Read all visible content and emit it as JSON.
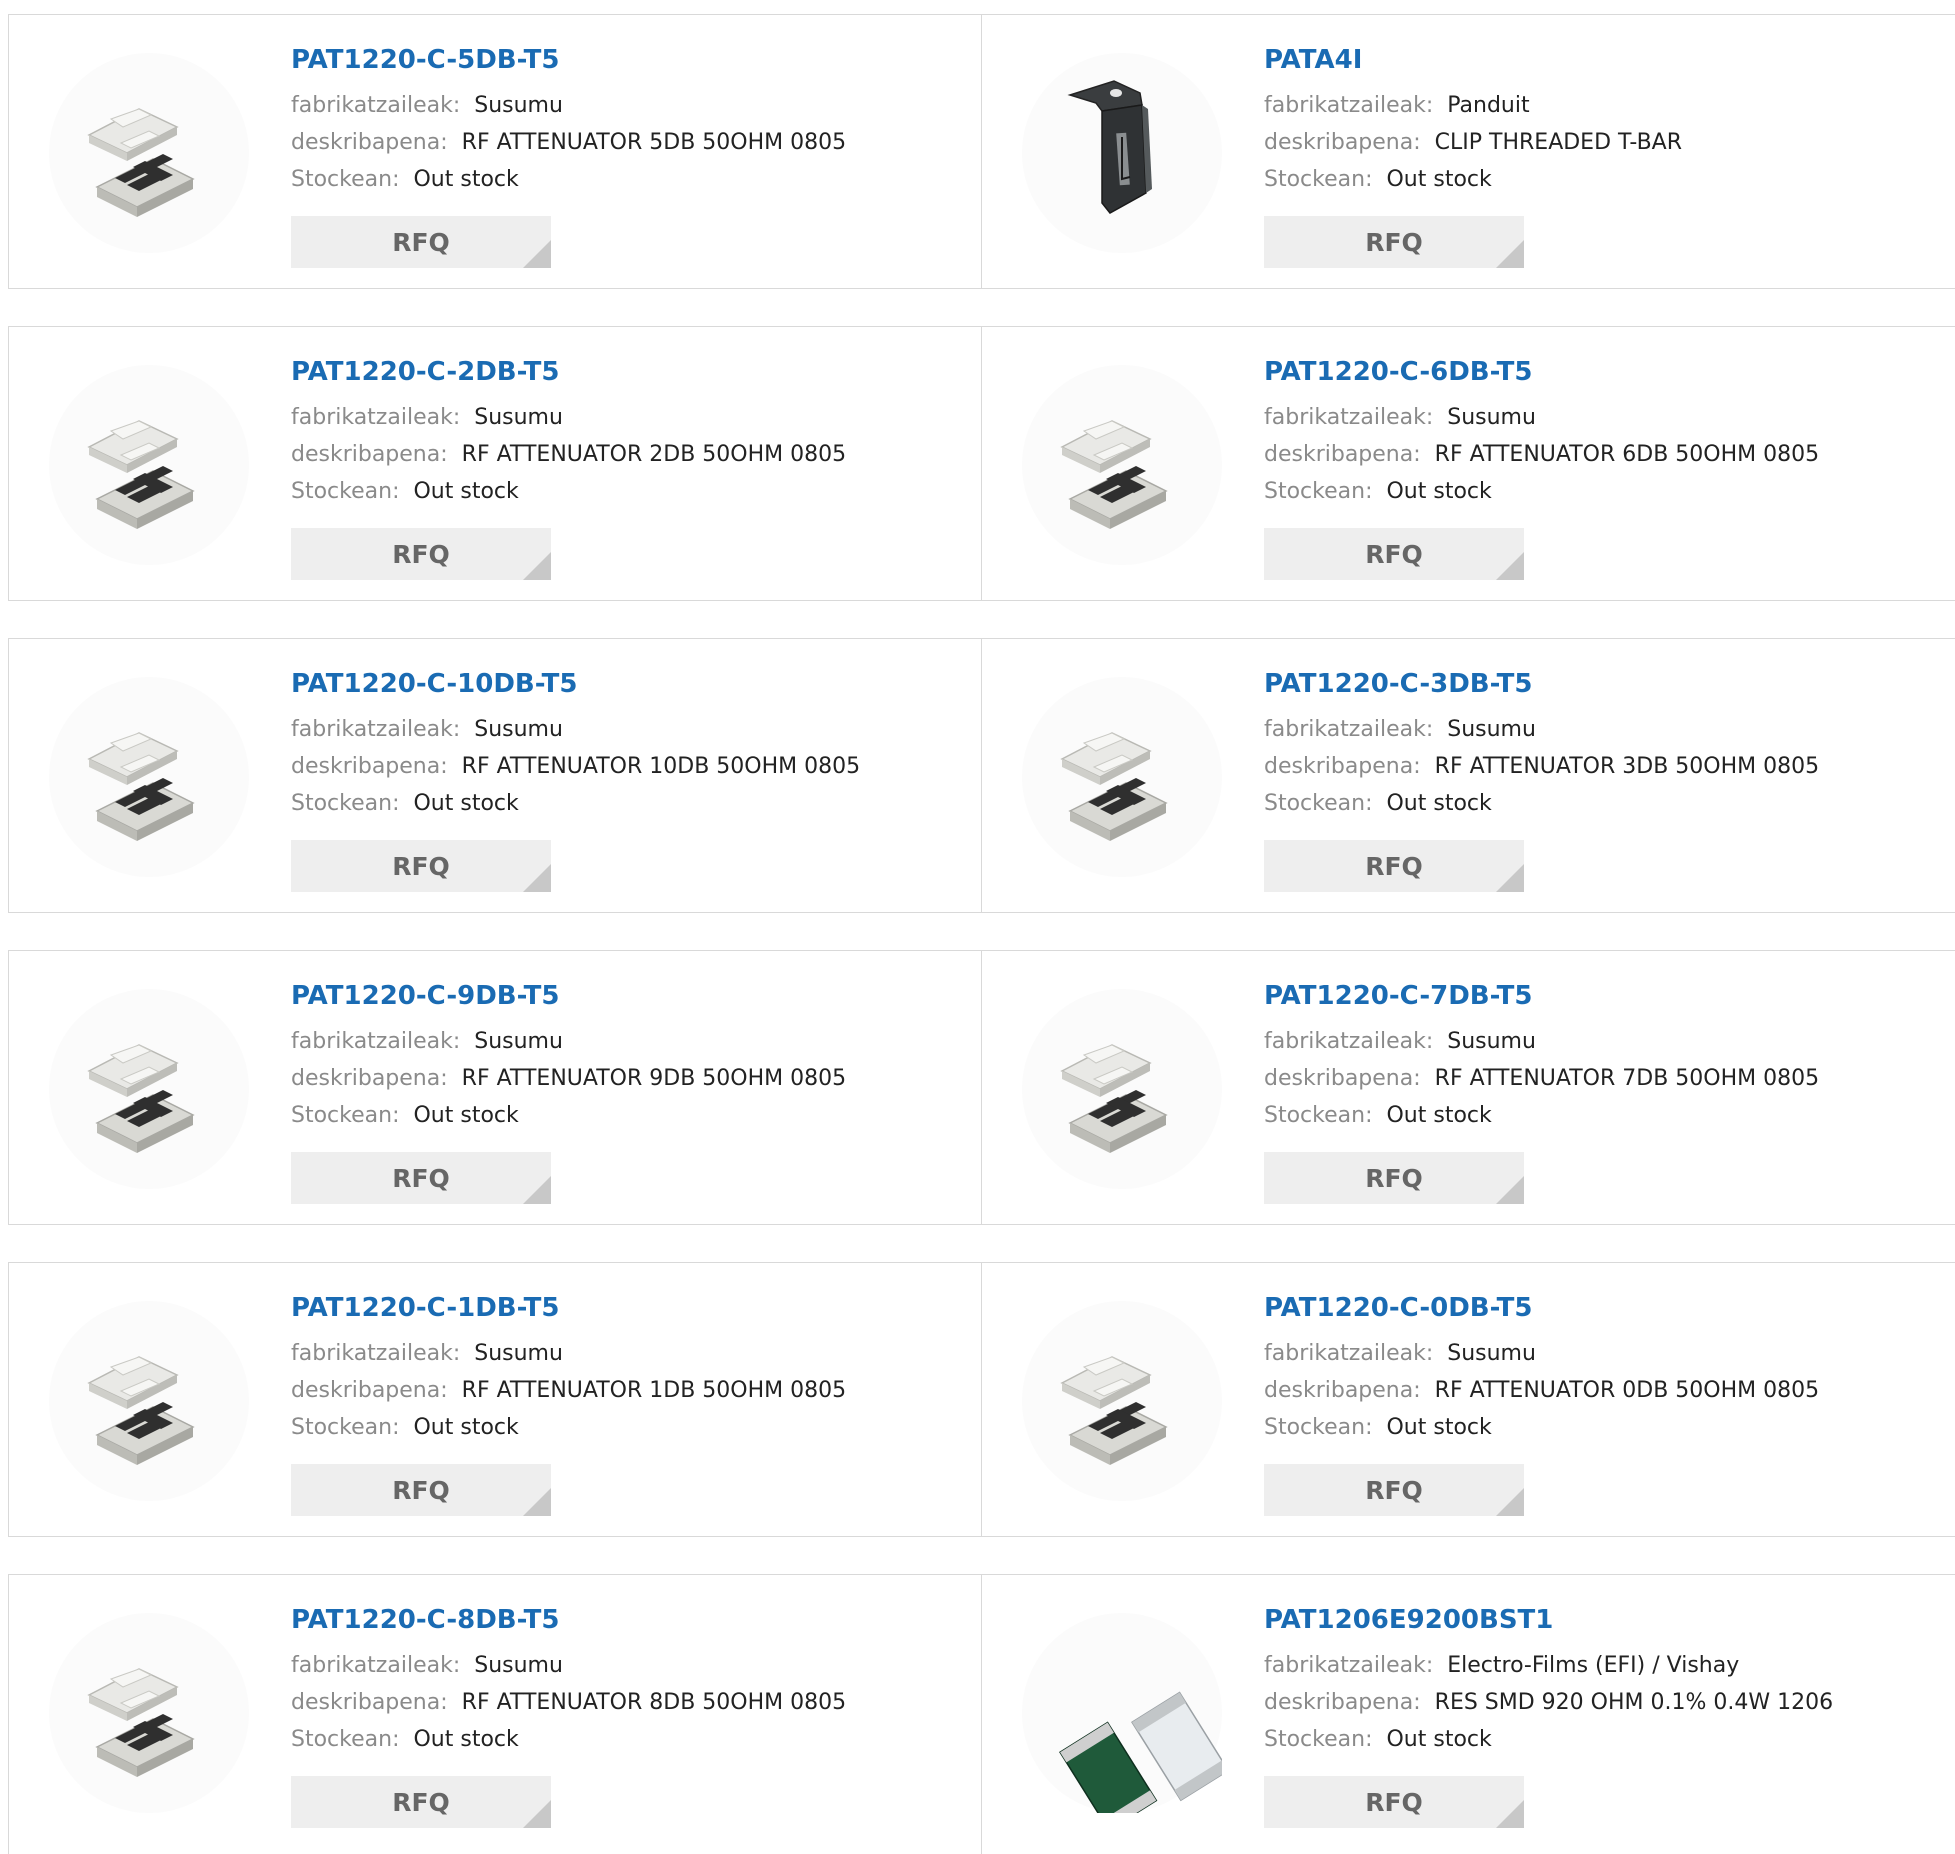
{
  "labels": {
    "manufacturer": "fabrikatzaileak:",
    "description": "deskribapena:",
    "stock": "Stockean:",
    "rfq": "RFQ"
  },
  "products": [
    {
      "part": "PAT1220-C-5DB-T5",
      "manufacturer": "Susumu",
      "description": "RF ATTENUATOR 5DB 50OHM 0805",
      "stock": "Out stock",
      "image": "chip-attenuator"
    },
    {
      "part": "PATA4I",
      "manufacturer": "Panduit",
      "description": "CLIP THREADED T-BAR",
      "stock": "Out stock",
      "image": "metal-clip"
    },
    {
      "part": "PAT1220-C-2DB-T5",
      "manufacturer": "Susumu",
      "description": "RF ATTENUATOR 2DB 50OHM 0805",
      "stock": "Out stock",
      "image": "chip-attenuator"
    },
    {
      "part": "PAT1220-C-6DB-T5",
      "manufacturer": "Susumu",
      "description": "RF ATTENUATOR 6DB 50OHM 0805",
      "stock": "Out stock",
      "image": "chip-attenuator"
    },
    {
      "part": "PAT1220-C-10DB-T5",
      "manufacturer": "Susumu",
      "description": "RF ATTENUATOR 10DB 50OHM 0805",
      "stock": "Out stock",
      "image": "chip-attenuator"
    },
    {
      "part": "PAT1220-C-3DB-T5",
      "manufacturer": "Susumu",
      "description": "RF ATTENUATOR 3DB 50OHM 0805",
      "stock": "Out stock",
      "image": "chip-attenuator"
    },
    {
      "part": "PAT1220-C-9DB-T5",
      "manufacturer": "Susumu",
      "description": "RF ATTENUATOR 9DB 50OHM 0805",
      "stock": "Out stock",
      "image": "chip-attenuator"
    },
    {
      "part": "PAT1220-C-7DB-T5",
      "manufacturer": "Susumu",
      "description": "RF ATTENUATOR 7DB 50OHM 0805",
      "stock": "Out stock",
      "image": "chip-attenuator"
    },
    {
      "part": "PAT1220-C-1DB-T5",
      "manufacturer": "Susumu",
      "description": "RF ATTENUATOR 1DB 50OHM 0805",
      "stock": "Out stock",
      "image": "chip-attenuator"
    },
    {
      "part": "PAT1220-C-0DB-T5",
      "manufacturer": "Susumu",
      "description": "RF ATTENUATOR 0DB 50OHM 0805",
      "stock": "Out stock",
      "image": "chip-attenuator"
    },
    {
      "part": "PAT1220-C-8DB-T5",
      "manufacturer": "Susumu",
      "description": "RF ATTENUATOR 8DB 50OHM 0805",
      "stock": "Out stock",
      "image": "chip-attenuator"
    },
    {
      "part": "PAT1206E9200BST1",
      "manufacturer": "Electro-Films (EFI) / Vishay",
      "description": "RES SMD 920 OHM 0.1% 0.4W 1206",
      "stock": "Out stock",
      "image": "smd-resistor"
    }
  ],
  "colors": {
    "link": "#1a6bb3",
    "label": "#8a8a8a",
    "border": "#d9d9d9",
    "button_bg": "#eeeeee"
  }
}
